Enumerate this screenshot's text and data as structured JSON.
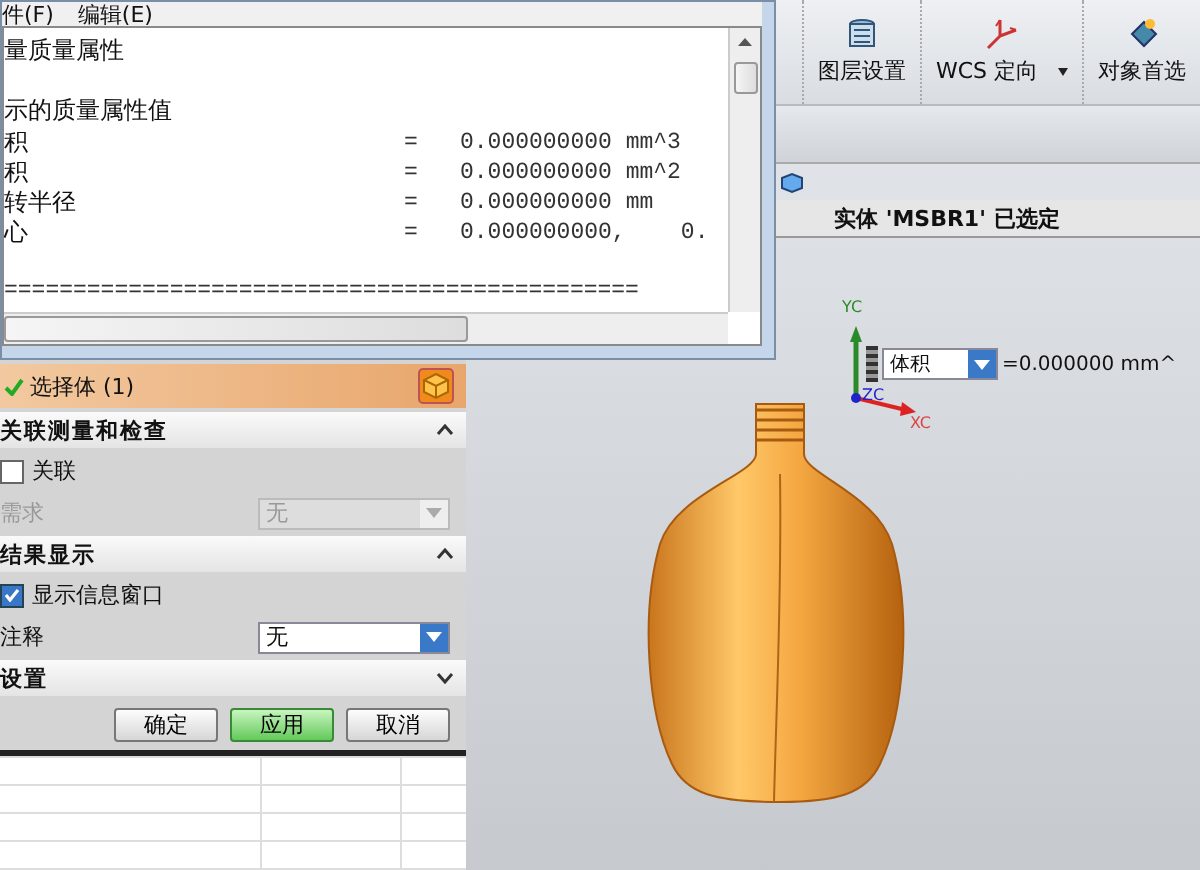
{
  "info_window": {
    "menu": [
      {
        "label": "件(F)"
      },
      {
        "label": "编辑(E)"
      }
    ],
    "lines": [
      {
        "kind": "heading",
        "text": "量质量属性"
      },
      {
        "kind": "blank"
      },
      {
        "kind": "heading",
        "text": "示的质量属性值"
      },
      {
        "kind": "value",
        "label": "积",
        "equals": "=",
        "value": "0.000000000 mm^3"
      },
      {
        "kind": "value",
        "label": "积",
        "equals": "=",
        "value": "0.000000000 mm^2"
      },
      {
        "kind": "value",
        "label": "转半径",
        "equals": "=",
        "value": "0.000000000 mm"
      },
      {
        "kind": "value",
        "label": "心",
        "equals": "=",
        "value": "0.000000000,    0."
      },
      {
        "kind": "blank"
      },
      {
        "kind": "rule",
        "text": "=============================================="
      }
    ]
  },
  "dialog": {
    "items": [
      {
        "kind": "selection",
        "label": "选择体 (1)"
      },
      {
        "kind": "section",
        "label": "关联测量和检查",
        "expanded": true
      },
      {
        "kind": "checkbox",
        "label": "关联",
        "checked": false
      },
      {
        "kind": "dropdown",
        "label": "需求",
        "value": "无",
        "disabled": true
      },
      {
        "kind": "section",
        "label": "结果显示",
        "expanded": true
      },
      {
        "kind": "checkbox",
        "label": "显示信息窗口",
        "checked": true
      },
      {
        "kind": "dropdown",
        "label": "注释",
        "value": "无",
        "disabled": false
      },
      {
        "kind": "section",
        "label": "设置",
        "expanded": false
      }
    ],
    "buttons": [
      {
        "label": "确定",
        "primary": false
      },
      {
        "label": "应用",
        "primary": true
      },
      {
        "label": "取消",
        "primary": false
      }
    ]
  },
  "toolbar": [
    {
      "label": "图层设置",
      "caret": false
    },
    {
      "label": "WCS 定向",
      "caret": true
    },
    {
      "label": "对象首选",
      "caret": false
    }
  ],
  "status": "实体 'MSBR1' 已选定",
  "graphics": {
    "axes": {
      "y": "YC",
      "z": "ZC",
      "x": "XC"
    },
    "readout": {
      "field": "体积",
      "value": "=0.000000 mm^"
    }
  }
}
